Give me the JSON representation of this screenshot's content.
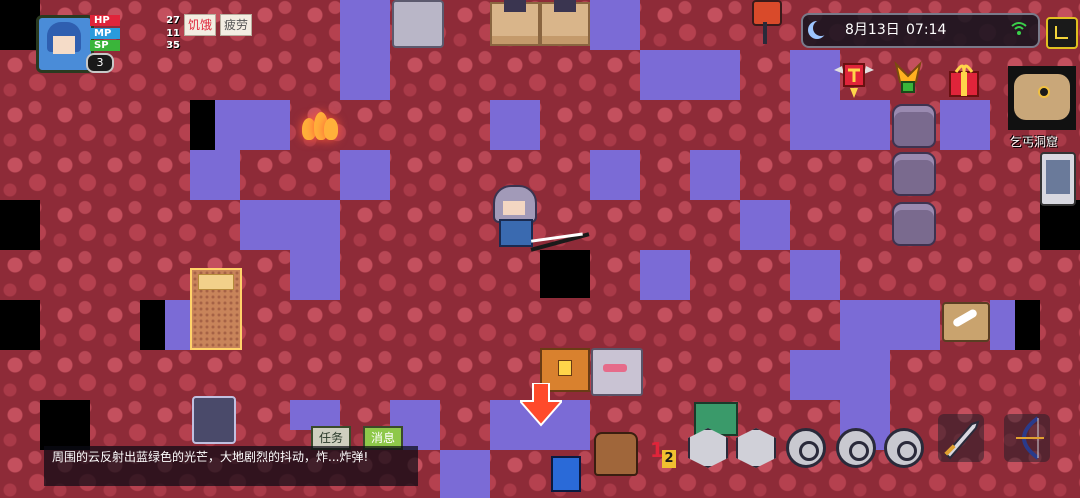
{
  "player": {
    "level": "3",
    "hp_label": "HP",
    "hp_value": "27",
    "mp_label": "MP",
    "mp_value": "11",
    "sp_label": "SP",
    "sp_value": "35",
    "status_effects": [
      "饥饿",
      "疲劳"
    ]
  },
  "clock": {
    "date": "8月13日",
    "time": "07:14",
    "icons": [
      "moon-icon",
      "wifi-icon"
    ]
  },
  "location": {
    "map_name": "乞丐洞窟"
  },
  "chat": {
    "tab_task": "任务",
    "tab_messages": "消息",
    "message": "周围的云反射出蓝绿色的光芒，大地剧烈的抖动，炸...炸弹!"
  },
  "toolbar": {
    "icons": [
      "book-icon",
      "backpack-icon",
      "hotkey-1-2-icon",
      "shield-icon",
      "skill-icon",
      "zoom-out-icon",
      "zoom-in-icon",
      "swap-icon",
      "sword-icon",
      "bow-icon"
    ]
  },
  "colors": {
    "floor": "#8e2b38",
    "purple_tile": "#7b6bd6",
    "hp": "#e0243a",
    "mp": "#2a9bdc",
    "sp": "#3ab53a"
  }
}
